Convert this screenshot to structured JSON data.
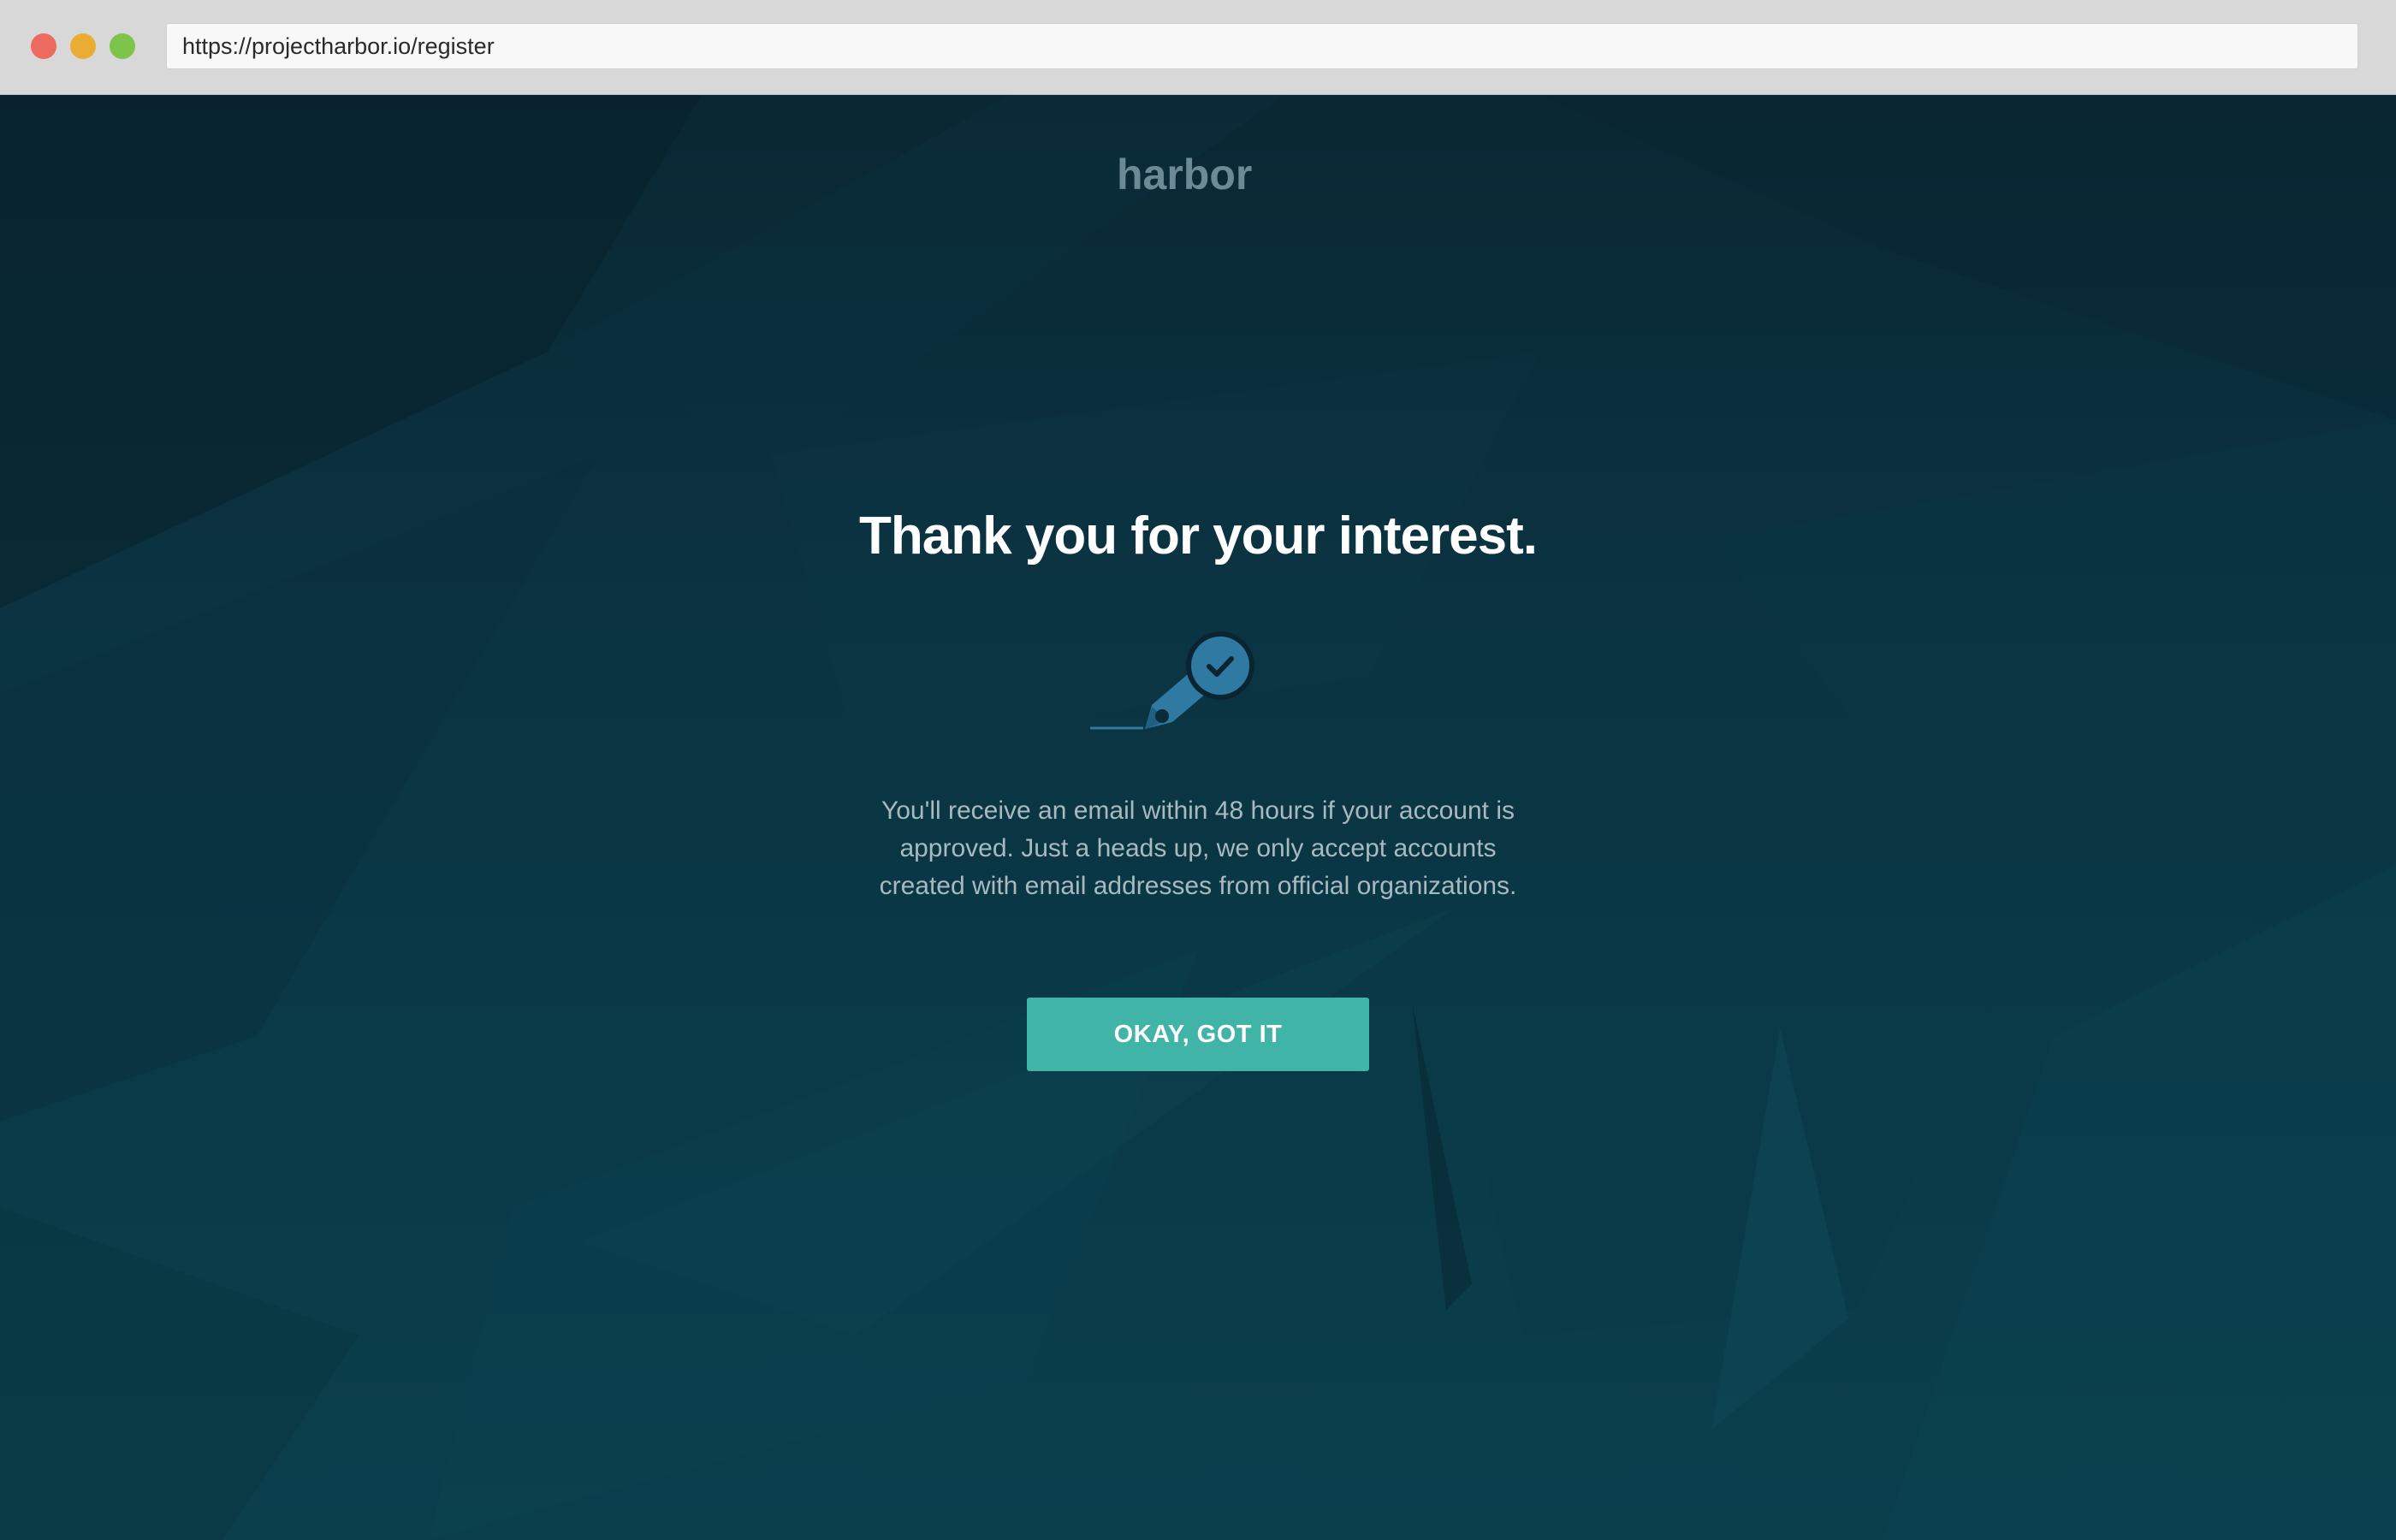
{
  "browser": {
    "url": "https://projectharbor.io/register"
  },
  "logo": {
    "text": "harbor",
    "color": "#6c8a95"
  },
  "confirmation": {
    "title": "Thank you for your interest.",
    "illustration_icon": "pen-signature-check-icon",
    "message": "You'll receive an email within 48 hours if your account is approved. Just a heads up, we only accept accounts created with email addresses from official organizations.",
    "button_label": "OKAY, GOT IT"
  },
  "colors": {
    "accent": "#41b4a8",
    "background_top": "#0a2733",
    "background_bottom": "#0b3f4c",
    "icon_blue": "#2e7aa3"
  }
}
